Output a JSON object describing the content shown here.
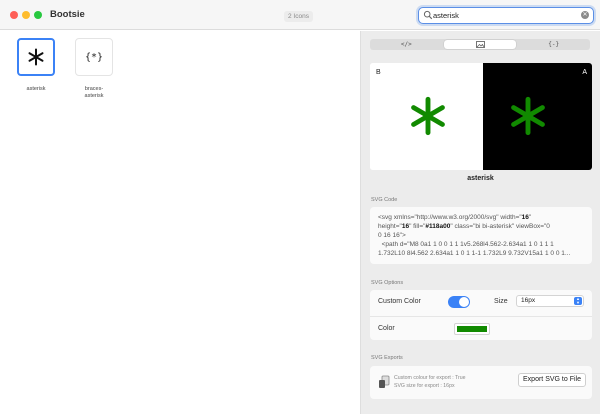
{
  "window": {
    "title": "Bootsie",
    "icon_count": "2 Icons"
  },
  "search": {
    "value": "asterisk"
  },
  "icons": [
    {
      "label": "asterisk",
      "selected": true
    },
    {
      "label": "braces-asterisk",
      "selected": false
    }
  ],
  "tabs": [
    "</>",
    "image",
    "{-}"
  ],
  "preview": {
    "light_label": "B",
    "dark_label": "A",
    "name": "asterisk",
    "color": "#118a00"
  },
  "svg_code": {
    "label": "SVG Code",
    "lines": [
      "<svg xmlns=\"http://www.w3.org/2000/svg\" width=\"16\"",
      "height=\"16\" fill=\"#118a00\" class=\"bi bi-asterisk\" viewBox=\"0",
      "0 16 16\">",
      "  <path d=\"M8 0a1 1 0 0 1 1 1v5.268l4.562-2.634a1 1 0 1 1 1",
      "1.732L10 8l4.562 2.634a1 1 0 1 1-1 1.732L9 9.732V15a1 1 0 0 1..."
    ]
  },
  "svg_options": {
    "label": "SVG Options",
    "custom_color_label": "Custom Color",
    "custom_color_on": true,
    "size_label": "Size",
    "size_value": "16px",
    "color_label": "Color",
    "color_value": "#118a00"
  },
  "svg_exports": {
    "label": "SVG Exports",
    "info_line1": "Custom colour for export : True",
    "info_line2": "SVG size for export : 16px",
    "button": "Export SVG to File"
  }
}
